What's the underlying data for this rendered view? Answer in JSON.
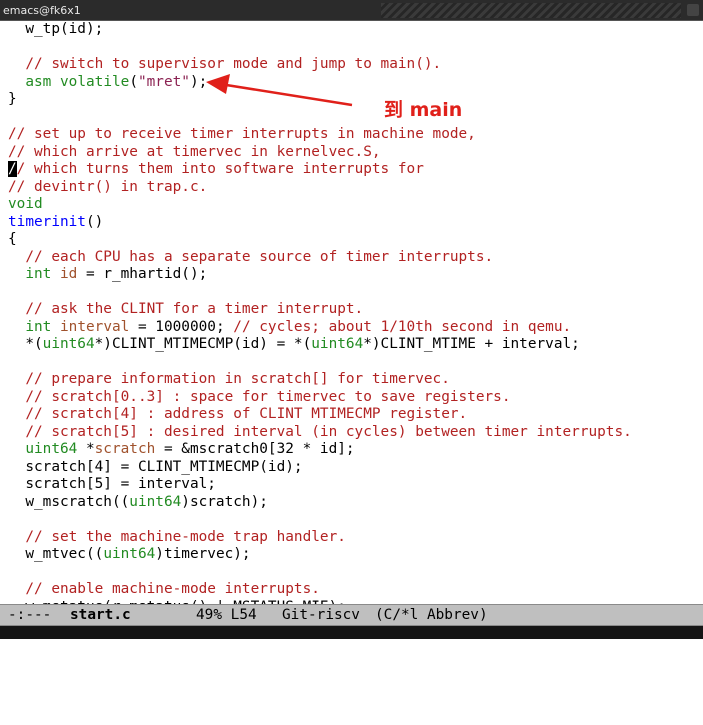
{
  "window": {
    "title": "emacs@fk6x1"
  },
  "annotation": {
    "text": "到 main",
    "color": "#e0201a"
  },
  "colors": {
    "comment": "#b22222",
    "keyword": "#a020f0",
    "function": "#0000ff",
    "type": "#228b22",
    "string": "#8b2252",
    "variable": "#a0522d"
  },
  "code_lines": [
    [
      {
        "t": "  w_tp(id);"
      }
    ],
    [
      {
        "t": ""
      }
    ],
    [
      {
        "t": "  "
      },
      {
        "t": "// switch to supervisor mode and jump to main().",
        "c": "cmt"
      }
    ],
    [
      {
        "t": "  "
      },
      {
        "t": "asm",
        "c": "ty"
      },
      {
        "t": " "
      },
      {
        "t": "volatile",
        "c": "ty"
      },
      {
        "t": "("
      },
      {
        "t": "\"mret\"",
        "c": "str"
      },
      {
        "t": ");"
      }
    ],
    [
      {
        "t": "}"
      }
    ],
    [
      {
        "t": ""
      }
    ],
    [
      {
        "t": "// set up to receive timer interrupts in machine mode,",
        "c": "cmt"
      }
    ],
    [
      {
        "t": "// which arrive at timervec in kernelvec.S,",
        "c": "cmt"
      }
    ],
    [
      {
        "t": "/",
        "c": "cursor"
      },
      {
        "t": "/ which turns them into software interrupts for",
        "c": "cmt"
      }
    ],
    [
      {
        "t": "// devintr() in trap.c.",
        "c": "cmt"
      }
    ],
    [
      {
        "t": "void",
        "c": "ty"
      }
    ],
    [
      {
        "t": "timerinit",
        "c": "fn"
      },
      {
        "t": "()"
      }
    ],
    [
      {
        "t": "{"
      }
    ],
    [
      {
        "t": "  "
      },
      {
        "t": "// each CPU has a separate source of timer interrupts.",
        "c": "cmt"
      }
    ],
    [
      {
        "t": "  "
      },
      {
        "t": "int",
        "c": "ty"
      },
      {
        "t": " "
      },
      {
        "t": "id",
        "c": "var"
      },
      {
        "t": " = r_mhartid();"
      }
    ],
    [
      {
        "t": ""
      }
    ],
    [
      {
        "t": "  "
      },
      {
        "t": "// ask the CLINT for a timer interrupt.",
        "c": "cmt"
      }
    ],
    [
      {
        "t": "  "
      },
      {
        "t": "int",
        "c": "ty"
      },
      {
        "t": " "
      },
      {
        "t": "interval",
        "c": "var"
      },
      {
        "t": " = 1000000; "
      },
      {
        "t": "// cycles; about 1/10th second in qemu.",
        "c": "cmt"
      }
    ],
    [
      {
        "t": "  *("
      },
      {
        "t": "uint64",
        "c": "ty"
      },
      {
        "t": "*)CLINT_MTIMECMP(id) = *("
      },
      {
        "t": "uint64",
        "c": "ty"
      },
      {
        "t": "*)CLINT_MTIME + interval;"
      }
    ],
    [
      {
        "t": ""
      }
    ],
    [
      {
        "t": "  "
      },
      {
        "t": "// prepare information in scratch[] for timervec.",
        "c": "cmt"
      }
    ],
    [
      {
        "t": "  "
      },
      {
        "t": "// scratch[0..3] : space for timervec to save registers.",
        "c": "cmt"
      }
    ],
    [
      {
        "t": "  "
      },
      {
        "t": "// scratch[4] : address of CLINT MTIMECMP register.",
        "c": "cmt"
      }
    ],
    [
      {
        "t": "  "
      },
      {
        "t": "// scratch[5] : desired interval (in cycles) between timer interrupts.",
        "c": "cmt"
      }
    ],
    [
      {
        "t": "  "
      },
      {
        "t": "uint64",
        "c": "ty"
      },
      {
        "t": " *"
      },
      {
        "t": "scratch",
        "c": "var"
      },
      {
        "t": " = &mscratch0[32 * id];"
      }
    ],
    [
      {
        "t": "  scratch[4] = CLINT_MTIMECMP(id);"
      }
    ],
    [
      {
        "t": "  scratch[5] = interval;"
      }
    ],
    [
      {
        "t": "  w_mscratch(("
      },
      {
        "t": "uint64",
        "c": "ty"
      },
      {
        "t": ")scratch);"
      }
    ],
    [
      {
        "t": ""
      }
    ],
    [
      {
        "t": "  "
      },
      {
        "t": "// set the machine-mode trap handler.",
        "c": "cmt"
      }
    ],
    [
      {
        "t": "  w_mtvec(("
      },
      {
        "t": "uint64",
        "c": "ty"
      },
      {
        "t": ")timervec);"
      }
    ],
    [
      {
        "t": ""
      }
    ],
    [
      {
        "t": "  "
      },
      {
        "t": "// enable machine-mode interrupts.",
        "c": "cmt"
      }
    ],
    [
      {
        "t": "  w_mstatus(r_mstatus() | MSTATUS_MIE);"
      }
    ]
  ],
  "modeline": {
    "status": "-:---",
    "buffer": "start.c",
    "position": "49% L54",
    "vc": "Git-riscv",
    "modes": "(C/*l Abbrev)"
  }
}
